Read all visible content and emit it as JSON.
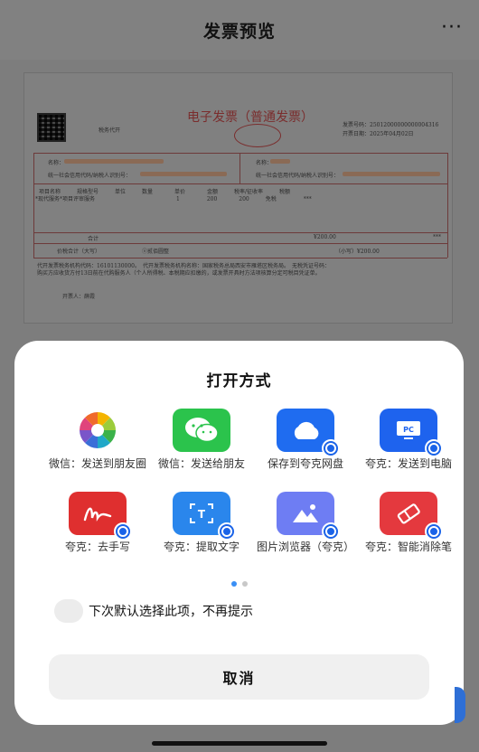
{
  "header": {
    "title": "发票预览",
    "more_label": "···"
  },
  "invoice": {
    "title": "电子发票（普通发票）",
    "agent_label": "税务代开",
    "number_label": "发票号码：25012000000000004316",
    "date_label": "开票日期：2025年04月02日",
    "buyer_name_label": "名称：",
    "buyer_tax_label": "统一社会信用代码/纳税人识别号：",
    "seller_name_label": "名称：",
    "seller_tax_label": "统一社会信用代码/纳税人识别号：",
    "item_header": "项目名称　　　规格型号　　　单位　　　数量　　　　单价　　　　金额　　　税率/征收率　　　税额",
    "item_row": "*现代服务*项目评审服务　　　　　　　　　　　　　　　1　　　　　200　　　　200　　　免税　　　　　***",
    "total_label": "合计",
    "total_amount": "¥200.00",
    "total_tax": "***",
    "grand_label": "价税合计（大写）",
    "grand_words": "ⓧ贰佰圆整",
    "grand_small": "（小写）¥200.00",
    "note_line1": "代开发票税务机构代码：16101130000。　代开发票税务机构名称：国家税务总局西安市雁塔区税务局。　无税凭证号码：",
    "note_line2": "购买方应收货方付13日前在代购服务人（个人所得税、本税期应扣缴的，或发票开具时方法项核算分定可税目凭证单。",
    "issuer_label": "开票人：薛霞"
  },
  "sheet": {
    "title": "打开方式",
    "items": [
      {
        "label": "微信：发送到朋友圈",
        "icon": "wechat-moments-icon",
        "color": "#ffffff"
      },
      {
        "label": "微信：发送给朋友",
        "icon": "wechat-icon",
        "color": "#2bc34c"
      },
      {
        "label": "保存到夸克网盘",
        "icon": "cloud-drive-icon",
        "color": "#1f6cf0"
      },
      {
        "label": "夸克：发送到电脑",
        "icon": "pc-icon",
        "color": "#1e63ee"
      },
      {
        "label": "夸克：去手写",
        "icon": "handwriting-icon",
        "color": "#df2f2f"
      },
      {
        "label": "夸克：提取文字",
        "icon": "text-extract-icon",
        "color": "#2a86ec"
      },
      {
        "label": "图片浏览器（夸克）",
        "icon": "image-viewer-icon",
        "color": "#6e7df3"
      },
      {
        "label": "夸克：智能消除笔",
        "icon": "eraser-icon",
        "color": "#e4393e"
      }
    ],
    "page_dots": 2,
    "remember_label": "下次默认选择此项，不再提示",
    "cancel_label": "取消"
  }
}
